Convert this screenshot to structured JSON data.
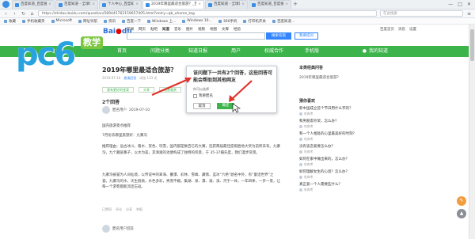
{
  "browser": {
    "tabs": [
      {
        "label": "百度知道_百度搜索",
        "active": false
      },
      {
        "label": "百度知道 - 全球领先中文...",
        "active": false
      },
      {
        "label": "个人中心_百度知道",
        "active": false
      },
      {
        "label": "2019年哪里最适合旅游？_百度知道",
        "active": true
      },
      {
        "label": "百度知道 - 全球领先中文...",
        "active": false
      },
      {
        "label": "百度知道_百度搜索",
        "active": false
      }
    ],
    "new_tab": "+",
    "url": "https://zhidao.baidu.com/question/589445762159657405.html?entry=qb_uhome_tag",
    "search_placeholder": "在此搜索",
    "window_controls": [
      "—",
      "□",
      "✕"
    ],
    "bookmarks": [
      "收藏",
      "手机收藏夹",
      "Microsoft",
      "网址导航",
      "资讯",
      "百度一下",
      "Windows 上...",
      "Windows 10...",
      "360手机",
      "打印机开关",
      "百度知道..."
    ]
  },
  "baidu": {
    "logo_bai": "Bai",
    "logo_du": "du",
    "logo_sub": "知道",
    "nav": [
      "新闻",
      "网页",
      "贴吧",
      "知道",
      "音乐",
      "图片",
      "视频",
      "地图",
      "文库",
      "经验"
    ],
    "nav_active": "知道",
    "search_button": "搜索答案",
    "ask_button": "我要提问",
    "top_right": [
      "百度首页",
      "消息",
      "设置"
    ]
  },
  "watermark": {
    "letters": "pc6",
    "badge": "教学"
  },
  "green_nav": {
    "items": [
      "首页",
      "问题分类",
      "知道日报",
      "用户",
      "权威合作",
      "手机版"
    ],
    "user_label": "我的知道"
  },
  "question": {
    "title": "2019年哪里最适合旅游？",
    "date": "2019-07-10",
    "meta_link": "邀请回答",
    "views": "浏览 123 次",
    "buttons": [
      "我有更好的答案",
      "分享",
      "设置悬赏"
    ],
    "answers_count": "2个回答",
    "answerer": "匿名用户",
    "answer_date": "2019-07-10",
    "answer_intro": "国内旅游景点推荐",
    "answer_lines": [
      "7月份去哪里旅游好：九寨沟",
      "推荐理由：远古冰川，看水、赏色、玩雪，国内都是数百亿的大赛，连获两届最佳度假胜地大奖为前所未有。九寨沟，九个藏族寨子，以水为美，其清澈的池塘构成了独特的风景，于 35-37摄氏度，我们漫步赏景。",
      "九寨沟被誉为人间仙境，以传说中的翠海、叠瀑、彩林、雪峰、藏情、蓝冰“六绝”驰名中外，有“童话世界”之誉。九寨沟的水，天生丽质，水色多彩，秀而不媚，集湖、泉、瀑、滩、溪、河于一体，一年四季，一步一景，让每一个游客都能流连忘返。"
    ],
    "answer_footer": [
      "已赞同",
      "评论",
      "分享",
      "举报"
    ],
    "second_answerer": "匿名用户回答"
  },
  "modal": {
    "message": "该问题下一共有2个回答，这些回答可能会帮助到其他网友",
    "select_label": "你可以选择",
    "checkbox_label": "我要匿名",
    "cancel": "取消",
    "confirm": "确定"
  },
  "sidebar": {
    "related_title": "本类经典问答",
    "related_q": "2019年哪里最适合旅游？",
    "hot_title": "猜你喜欢",
    "hot_items": [
      {
        "q": "新中国成立首个节日用什么字的？",
        "who": "吃肉考"
      },
      {
        "q": "和男朋友吵架，怎么办？",
        "who": "吃肉考"
      },
      {
        "q": "和一个人相处的心里最美好的时刻？",
        "who": "吃肉考"
      },
      {
        "q": "没有谈恋爱要怎么办？",
        "who": "吃肉考"
      },
      {
        "q": "如何在家中做出来的，怎么办？",
        "who": "吃肉考"
      },
      {
        "q": "如何理解女生的心思？怎么办？",
        "who": "吃肉考"
      },
      {
        "q": "真正爱一个人需要些什么？",
        "who": "吃肉考"
      }
    ]
  },
  "colors": {
    "green": "#3cb44b",
    "blue": "#3385ff",
    "red_arrow": "#e0332b"
  }
}
